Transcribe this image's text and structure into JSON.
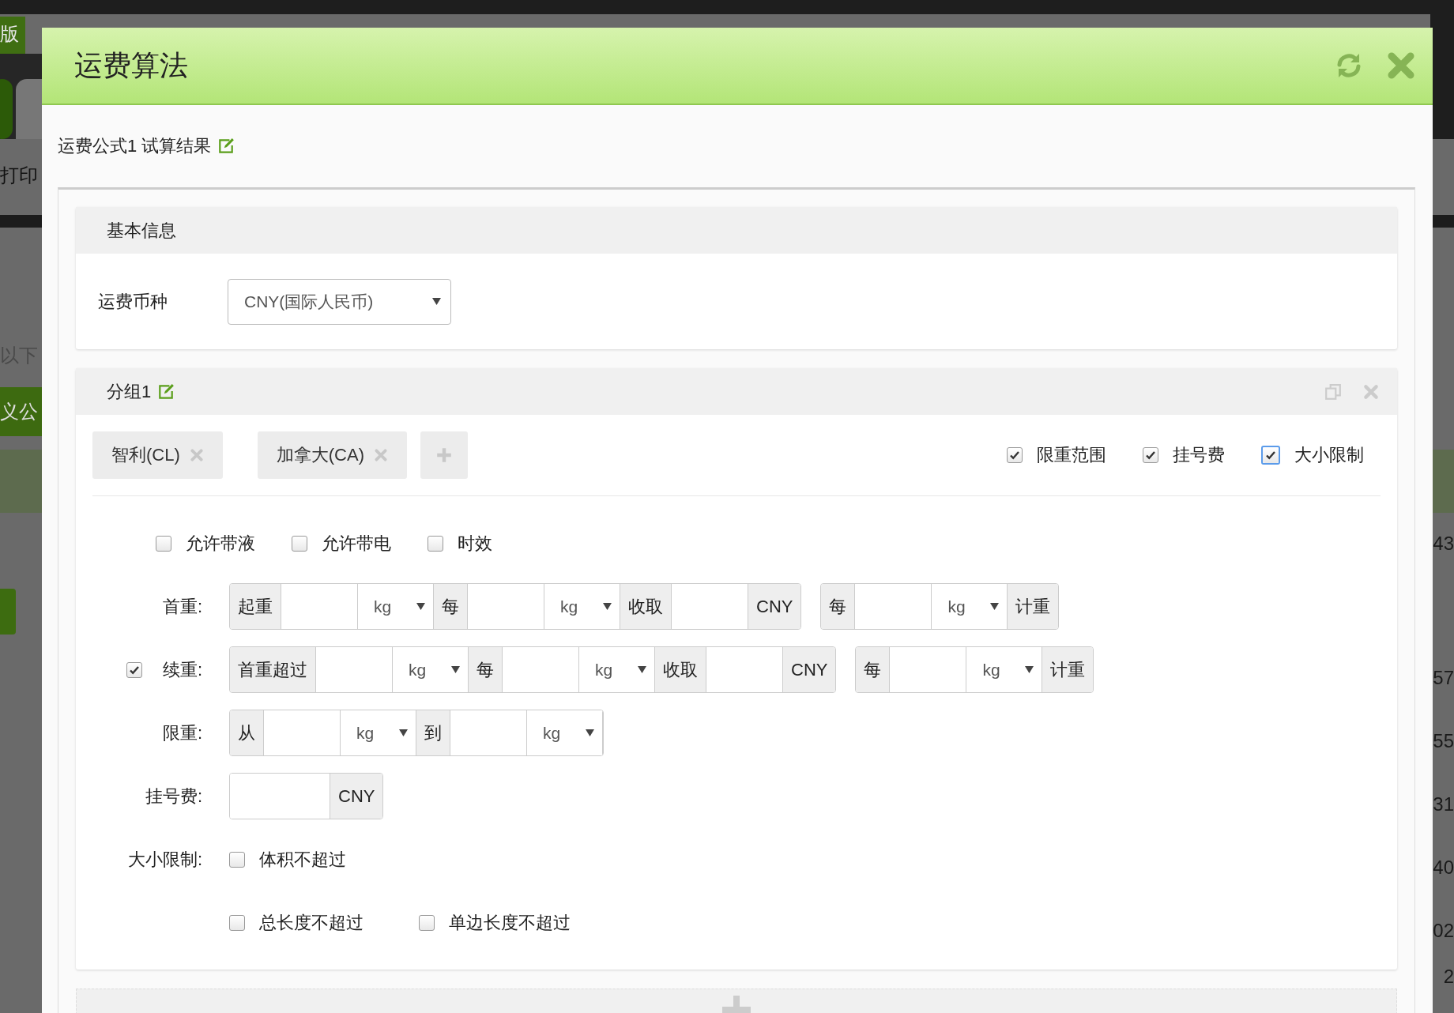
{
  "background_page": {
    "left_texts": [
      {
        "kind": "tab",
        "text": "版"
      },
      {
        "kind": "plain",
        "text": "打印"
      },
      {
        "kind": "hint",
        "text": "以下"
      },
      {
        "kind": "band",
        "text": "义公"
      }
    ],
    "right_numbers": [
      "43",
      "57",
      "55",
      "31",
      "40",
      "02",
      "2"
    ]
  },
  "dialog": {
    "title": "运费算法"
  },
  "formula": {
    "title": "运费公式1 试算结果"
  },
  "basic_info": {
    "title": "基本信息",
    "currency_label": "运费币种",
    "currency_value": "CNY(国际人民币)"
  },
  "group": {
    "title": "分组1",
    "countries": [
      "智利(CL)",
      "加拿大(CA)"
    ],
    "options": [
      {
        "label": "限重范围",
        "checked": true,
        "focused": false
      },
      {
        "label": "挂号费",
        "checked": true,
        "focused": false
      },
      {
        "label": "大小限制",
        "checked": true,
        "focused": true
      }
    ],
    "flags": [
      {
        "label": "允许带液",
        "checked": false
      },
      {
        "label": "允许带电",
        "checked": false
      },
      {
        "label": "时效",
        "checked": false
      }
    ],
    "rows": [
      {
        "label": "首重:",
        "groups": [
          [
            {
              "kind": "addon",
              "text": "起重"
            },
            {
              "kind": "input"
            },
            {
              "kind": "select",
              "text": "kg"
            },
            {
              "kind": "addon",
              "text": "每"
            },
            {
              "kind": "input"
            },
            {
              "kind": "select",
              "text": "kg"
            },
            {
              "kind": "addon",
              "text": "收取"
            },
            {
              "kind": "input"
            },
            {
              "kind": "addon",
              "text": "CNY"
            }
          ],
          [
            {
              "kind": "addon",
              "text": "每"
            },
            {
              "kind": "input"
            },
            {
              "kind": "select",
              "text": "kg"
            },
            {
              "kind": "addon",
              "text": "计重"
            }
          ]
        ]
      },
      {
        "label": "续重:",
        "checked": true,
        "groups": [
          [
            {
              "kind": "addon",
              "text": "首重超过"
            },
            {
              "kind": "input"
            },
            {
              "kind": "select",
              "text": "kg"
            },
            {
              "kind": "addon",
              "text": "每"
            },
            {
              "kind": "input"
            },
            {
              "kind": "select",
              "text": "kg"
            },
            {
              "kind": "addon",
              "text": "收取"
            },
            {
              "kind": "input"
            },
            {
              "kind": "addon",
              "text": "CNY"
            }
          ],
          [
            {
              "kind": "addon",
              "text": "每"
            },
            {
              "kind": "input"
            },
            {
              "kind": "select",
              "text": "kg"
            },
            {
              "kind": "addon",
              "text": "计重"
            }
          ]
        ]
      },
      {
        "label": "限重:",
        "groups": [
          [
            {
              "kind": "addon",
              "text": "从"
            },
            {
              "kind": "input"
            },
            {
              "kind": "select",
              "text": "kg"
            },
            {
              "kind": "addon",
              "text": "到"
            },
            {
              "kind": "input"
            },
            {
              "kind": "select",
              "text": "kg"
            }
          ]
        ]
      },
      {
        "label": "挂号费:",
        "groups": [
          [
            {
              "kind": "input"
            },
            {
              "kind": "addon",
              "text": "CNY"
            }
          ]
        ]
      }
    ],
    "size_limit": {
      "label": "大小限制:",
      "lines": [
        [
          {
            "label": "体积不超过",
            "checked": false
          }
        ],
        [
          {
            "label": "总长度不超过",
            "checked": false
          },
          {
            "label": "单边长度不超过",
            "checked": false
          }
        ]
      ]
    }
  }
}
